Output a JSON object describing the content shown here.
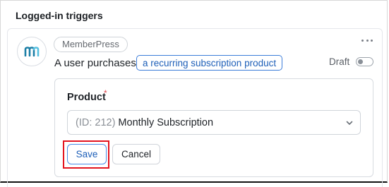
{
  "section": {
    "title": "Logged-in triggers"
  },
  "trigger": {
    "integration_badge": "MemberPress",
    "sentence_prefix": "A user purchases",
    "product_chip": "a recurring subscription product",
    "status_label": "Draft",
    "status_enabled": false,
    "logo_icon": "memberpress-logo-icon",
    "logo_color": "#1c7ea6",
    "menu_icon": "more-horizontal-icon"
  },
  "form": {
    "field_label": "Product",
    "required_mark": "*",
    "select_id_prefix": "(ID: 212)",
    "select_value": "Monthly Subscription",
    "select_icon": "chevron-down-icon",
    "save_label": "Save",
    "cancel_label": "Cancel"
  },
  "colors": {
    "accent": "#1e5fb8",
    "highlight": "#e3141f",
    "required": "#e0484f"
  }
}
